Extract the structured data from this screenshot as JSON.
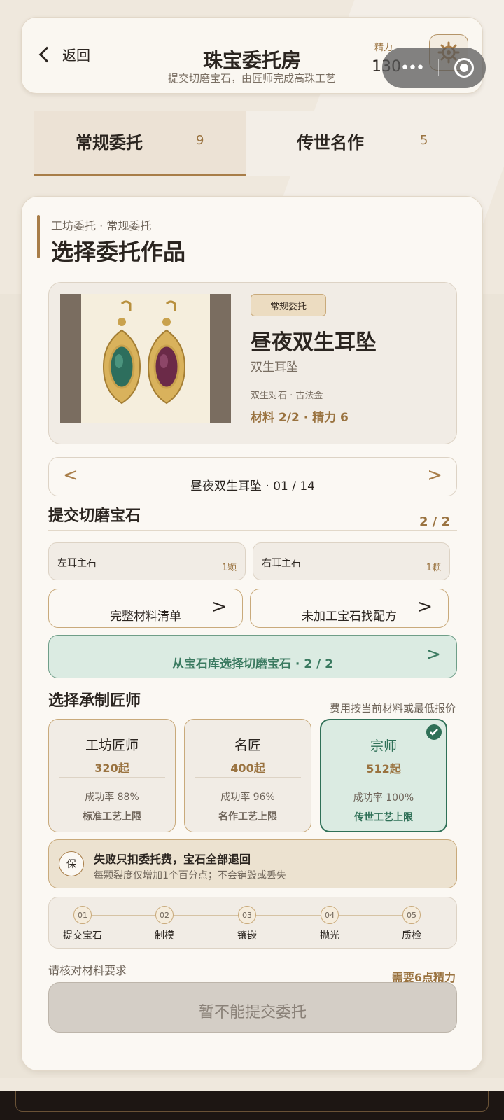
{
  "header": {
    "back_label": "返回",
    "title": "珠宝委托房",
    "subtitle": "提交切磨宝石，由匠师完成高珠工艺",
    "energy_label": "精力",
    "energy_value": "130"
  },
  "tabs": [
    {
      "label": "常规委托",
      "count": "9"
    },
    {
      "label": "传世名作",
      "count": "5"
    }
  ],
  "main": {
    "breadcrumb": "工坊委托 · 常规委托",
    "section_title": "选择委托作品",
    "product": {
      "badge": "常规委托",
      "name": "昼夜双生耳坠",
      "subtitle": "双生耳坠",
      "materials": "双生对石 · 古法金",
      "cost": "材料 2/2 · 精力 6"
    },
    "pager": {
      "prev": "<",
      "label": "昼夜双生耳坠 · 01 / 14",
      "next": ">"
    },
    "gems": {
      "title": "提交切磨宝石",
      "progress": "2 / 2",
      "slots": [
        {
          "name": "左耳主石",
          "qty": "1颗"
        },
        {
          "name": "右耳主石",
          "qty": "1颗"
        }
      ],
      "material_list": "完整材料清单",
      "raw_recipe": "未加工宝石找配方",
      "select_gems": "从宝石库选择切磨宝石 · 2 / 2"
    },
    "smiths": {
      "title": "选择承制匠师",
      "note": "费用按当前材料或最低报价",
      "items": [
        {
          "name": "工坊匠师",
          "price": "320起",
          "rate": "成功率 88%",
          "limit": "标准工艺上限"
        },
        {
          "name": "名匠",
          "price": "400起",
          "rate": "成功率 96%",
          "limit": "名作工艺上限"
        },
        {
          "name": "宗师",
          "price": "512起",
          "rate": "成功率 100%",
          "limit": "传世工艺上限"
        }
      ]
    },
    "guarantee": {
      "icon_text": "保",
      "title": "失败只扣委托费，宝石全部退回",
      "desc": "每颗裂度仅增加1个百分点；不会销毁或丢失"
    },
    "steps": [
      {
        "num": "01",
        "label": "提交宝石"
      },
      {
        "num": "02",
        "label": "制模"
      },
      {
        "num": "03",
        "label": "镶嵌"
      },
      {
        "num": "04",
        "label": "抛光"
      },
      {
        "num": "05",
        "label": "质检"
      }
    ],
    "verify_note": "请核对材料要求",
    "need_energy": "需要6点精力",
    "submit_label": "暂不能提交委托"
  },
  "colors": {
    "accent_gold": "#a87d48",
    "selected_green": "#2f7057",
    "card_bg": "#fbf8f3"
  },
  "icons": [
    "back-chevron-icon",
    "gear-icon",
    "more-dots-icon",
    "target-icon",
    "check-icon",
    "earring-image"
  ]
}
